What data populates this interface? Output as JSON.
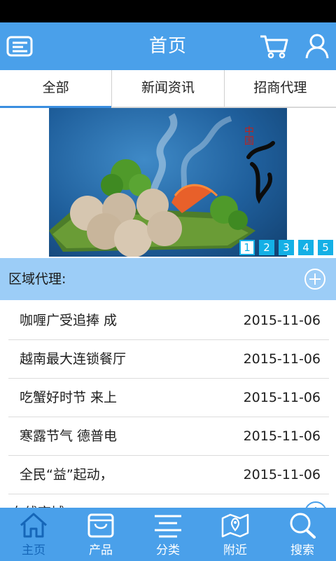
{
  "header": {
    "title": "首页"
  },
  "tabs": [
    {
      "label": "全部",
      "active": true
    },
    {
      "label": "新闻资讯",
      "active": false
    },
    {
      "label": "招商代理",
      "active": false
    }
  ],
  "banner": {
    "calligraphy": "中国",
    "pager": [
      "1",
      "2",
      "3",
      "4",
      "5"
    ],
    "active_page": "1"
  },
  "section": {
    "label": "区域代理:"
  },
  "news": [
    {
      "title": "咖喱广受追捧 成",
      "date": "2015-11-06"
    },
    {
      "title": "越南最大连锁餐厅",
      "date": "2015-11-06"
    },
    {
      "title": "吃蟹好时节 来上",
      "date": "2015-11-06"
    },
    {
      "title": "寒露节气 德普电",
      "date": "2015-11-06"
    },
    {
      "title": "全民“益”起动，",
      "date": "2015-11-06"
    }
  ],
  "next_section": {
    "label": "在线商城"
  },
  "bottom_nav": [
    {
      "label": "主页",
      "icon": "home-icon",
      "active": true
    },
    {
      "label": "产品",
      "icon": "bag-icon",
      "active": false
    },
    {
      "label": "分类",
      "icon": "list-icon",
      "active": false
    },
    {
      "label": "附近",
      "icon": "map-icon",
      "active": false
    },
    {
      "label": "搜索",
      "icon": "search-icon",
      "active": false
    }
  ],
  "colors": {
    "primary": "#4aa0ea",
    "section_bg": "#9ccdf7",
    "pager": "#14b0e6",
    "nav_active": "#1566b8"
  }
}
